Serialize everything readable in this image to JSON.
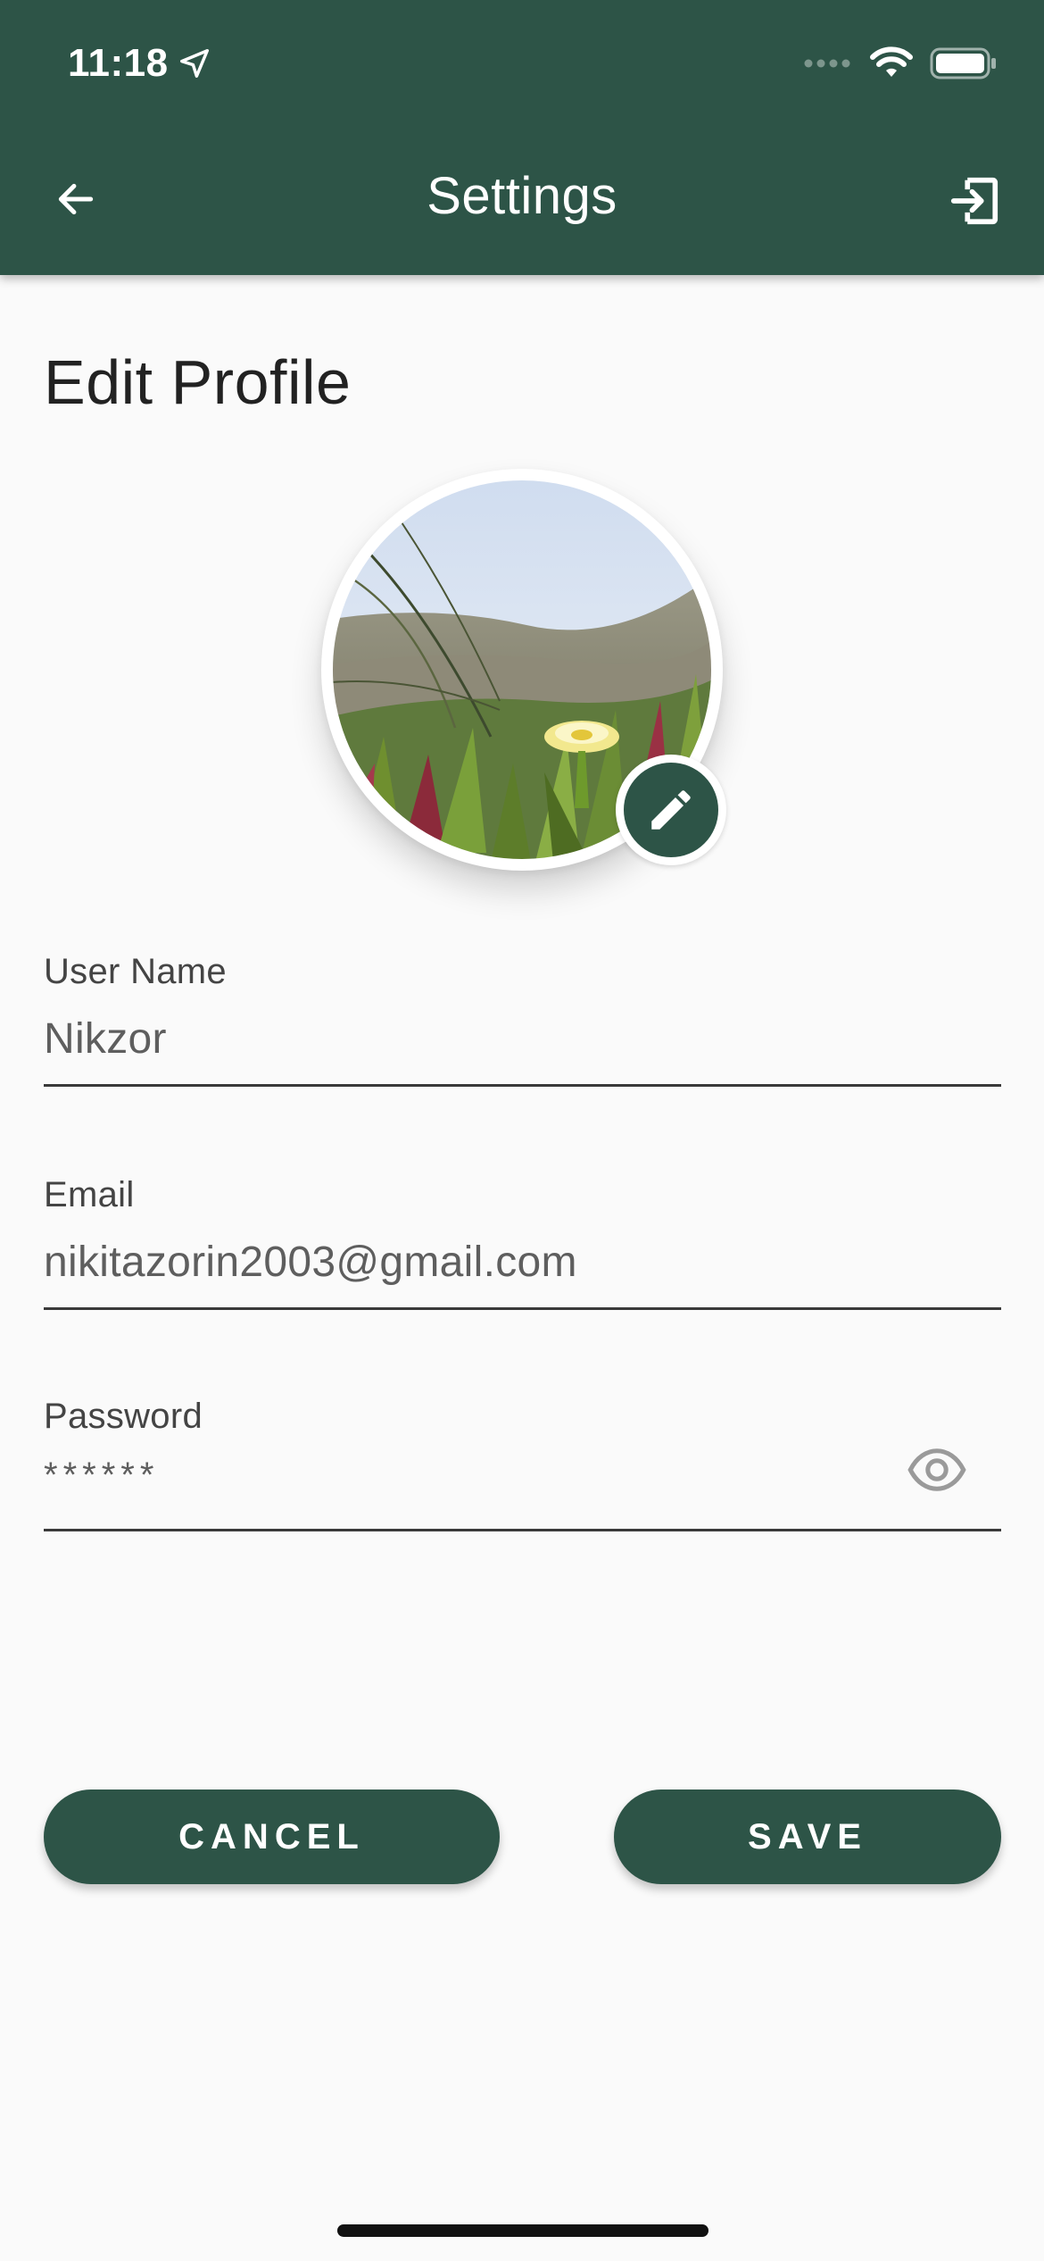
{
  "status_bar": {
    "time": "11:18",
    "icons": [
      "location-arrow-icon",
      "signal-dots-icon",
      "wifi-icon",
      "battery-icon"
    ]
  },
  "header": {
    "title": "Settings",
    "back_icon": "arrow-left-icon",
    "logout_icon": "logout-icon",
    "background_color": "#2d5447"
  },
  "page": {
    "heading": "Edit Profile"
  },
  "avatar": {
    "edit_icon": "pencil-icon"
  },
  "form": {
    "username": {
      "label": "User Name",
      "value": "Nikzor"
    },
    "email": {
      "label": "Email",
      "value": "nikitazorin2003@gmail.com"
    },
    "password": {
      "label": "Password",
      "value": "******",
      "toggle_icon": "eye-icon"
    }
  },
  "actions": {
    "cancel_label": "CANCEL",
    "save_label": "SAVE",
    "button_color": "#2d5447"
  }
}
